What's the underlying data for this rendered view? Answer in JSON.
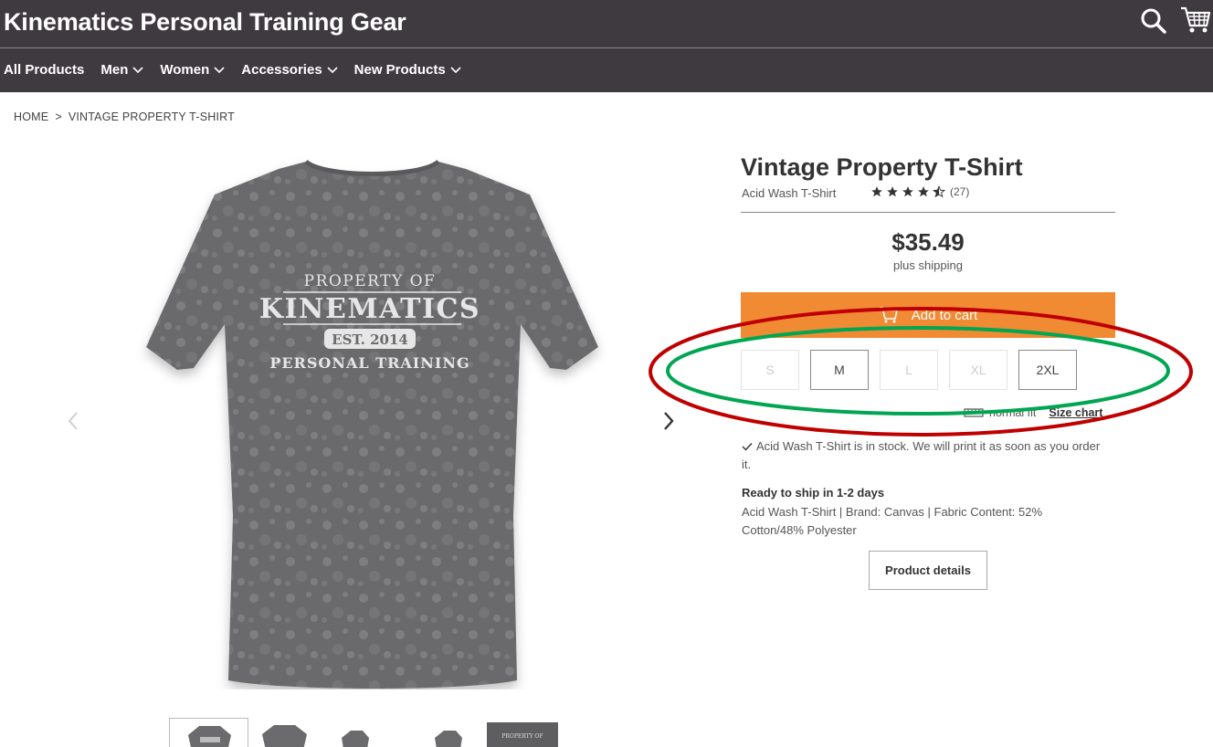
{
  "header": {
    "store_title": "Kinematics Personal Training Gear",
    "search_icon": "search-icon",
    "cart_icon": "cart-icon"
  },
  "nav": {
    "items": [
      {
        "label": "All Products",
        "has_dropdown": false
      },
      {
        "label": "Men",
        "has_dropdown": true
      },
      {
        "label": "Women",
        "has_dropdown": true
      },
      {
        "label": "Accessories",
        "has_dropdown": true
      },
      {
        "label": "New Products",
        "has_dropdown": true
      }
    ]
  },
  "breadcrumb": {
    "home": "HOME",
    "separator": ">",
    "current": "VINTAGE PROPERTY T-SHIRT"
  },
  "product": {
    "title": "Vintage Property T-Shirt",
    "subtitle": "Acid Wash T-Shirt",
    "rating": 4.5,
    "review_count": "(27)",
    "price": "$35.49",
    "shipping_note": "plus shipping",
    "add_to_cart_label": "Add to cart",
    "sizes": [
      {
        "label": "S",
        "available": false
      },
      {
        "label": "M",
        "available": true
      },
      {
        "label": "L",
        "available": false
      },
      {
        "label": "XL",
        "available": false
      },
      {
        "label": "2XL",
        "available": true
      }
    ],
    "fit_label": "normal fit",
    "size_chart_label": "Size chart",
    "stock_message": "Acid Wash T-Shirt is in stock. We will print it as soon as you order it.",
    "ship_title": "Ready to ship in 1-2 days",
    "ship_description": "Acid Wash T-Shirt | Brand: Canvas | Fabric Content: 52% Cotton/48% Polyester",
    "details_button_label": "Product details"
  },
  "shirt_graphic": {
    "line1": "PROPERTY OF",
    "line2": "KINEMATICS",
    "line3": "EST. 2014",
    "line4": "PERSONAL TRAINING"
  },
  "thumbnails": {
    "thumb5_text": "PROPERTY OF"
  },
  "colors": {
    "header_bg": "#3f3a3f",
    "add_to_cart_bg": "#f08a33",
    "shirt_color": "#6e6e70",
    "annotation_red": "#c00000",
    "annotation_green": "#00a651"
  }
}
